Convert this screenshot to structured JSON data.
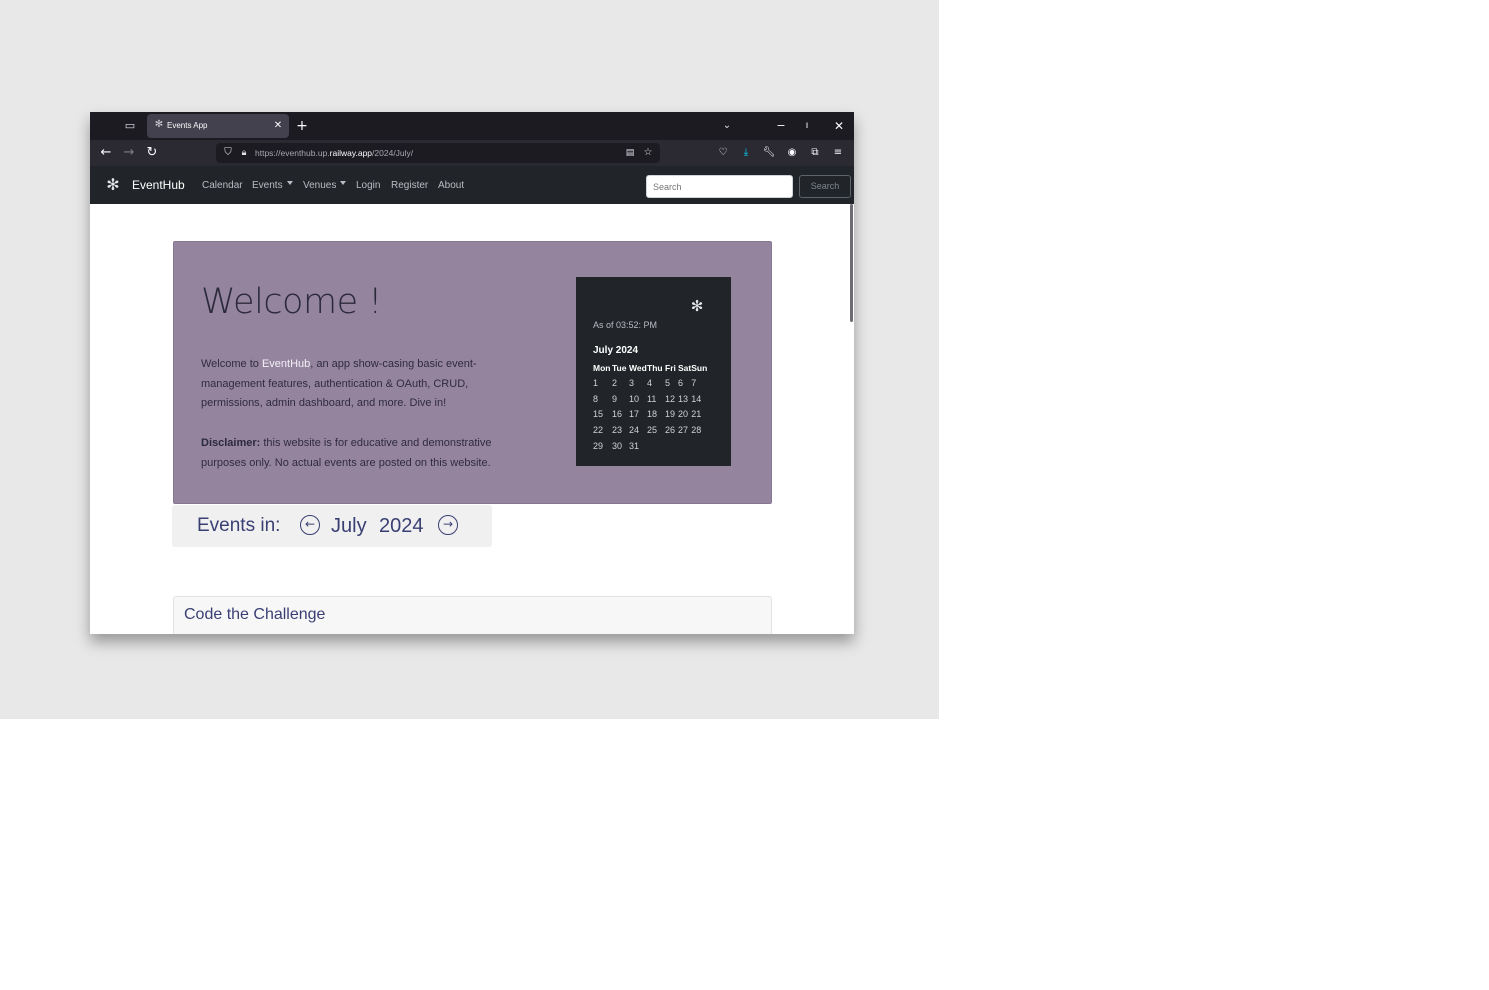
{
  "browser": {
    "tab_title": "Events App",
    "url_prefix": "https://eventhub.up.",
    "url_domain": "railway.app",
    "url_suffix": "/2024/July/"
  },
  "site": {
    "brand": "EventHub",
    "nav": {
      "calendar": "Calendar",
      "events": "Events",
      "venues": "Venues",
      "login": "Login",
      "register": "Register",
      "about": "About"
    },
    "search_placeholder": "Search",
    "search_button": "Search"
  },
  "hero": {
    "title": "Welcome !",
    "intro_before": "Welcome to ",
    "intro_brand": "EventHub",
    "intro_after": ", an app show-casing basic event-management features, authentication & OAuth, CRUD, permissions, admin dashboard, and more. Dive in!",
    "disclaimer_label": "Disclaimer:",
    "disclaimer_text": " this website is for educative and demonstrative purposes only. No actual events are posted on this website."
  },
  "calendar": {
    "as_of": "As of 03:52: PM",
    "month_title": "July 2024",
    "weekdays": [
      "Mon",
      "Tue",
      "Wed",
      "Thu",
      "Fri",
      "Sat",
      "Sun"
    ],
    "weeks": [
      [
        "1",
        "2",
        "3",
        "4",
        "5",
        "6",
        "7"
      ],
      [
        "8",
        "9",
        "10",
        "11",
        "12",
        "13",
        "14"
      ],
      [
        "15",
        "16",
        "17",
        "18",
        "19",
        "20",
        "21"
      ],
      [
        "22",
        "23",
        "24",
        "25",
        "26",
        "27",
        "28"
      ],
      [
        "29",
        "30",
        "31",
        "",
        "",
        "",
        ""
      ]
    ]
  },
  "events_header": {
    "label": "Events in:",
    "month": "July",
    "year": "2024"
  },
  "events": [
    {
      "title": "Code the Challenge"
    }
  ],
  "colors": {
    "hero_bg": "#95849e",
    "navbar_bg": "#212529",
    "heading_blue": "#3a3f73"
  }
}
